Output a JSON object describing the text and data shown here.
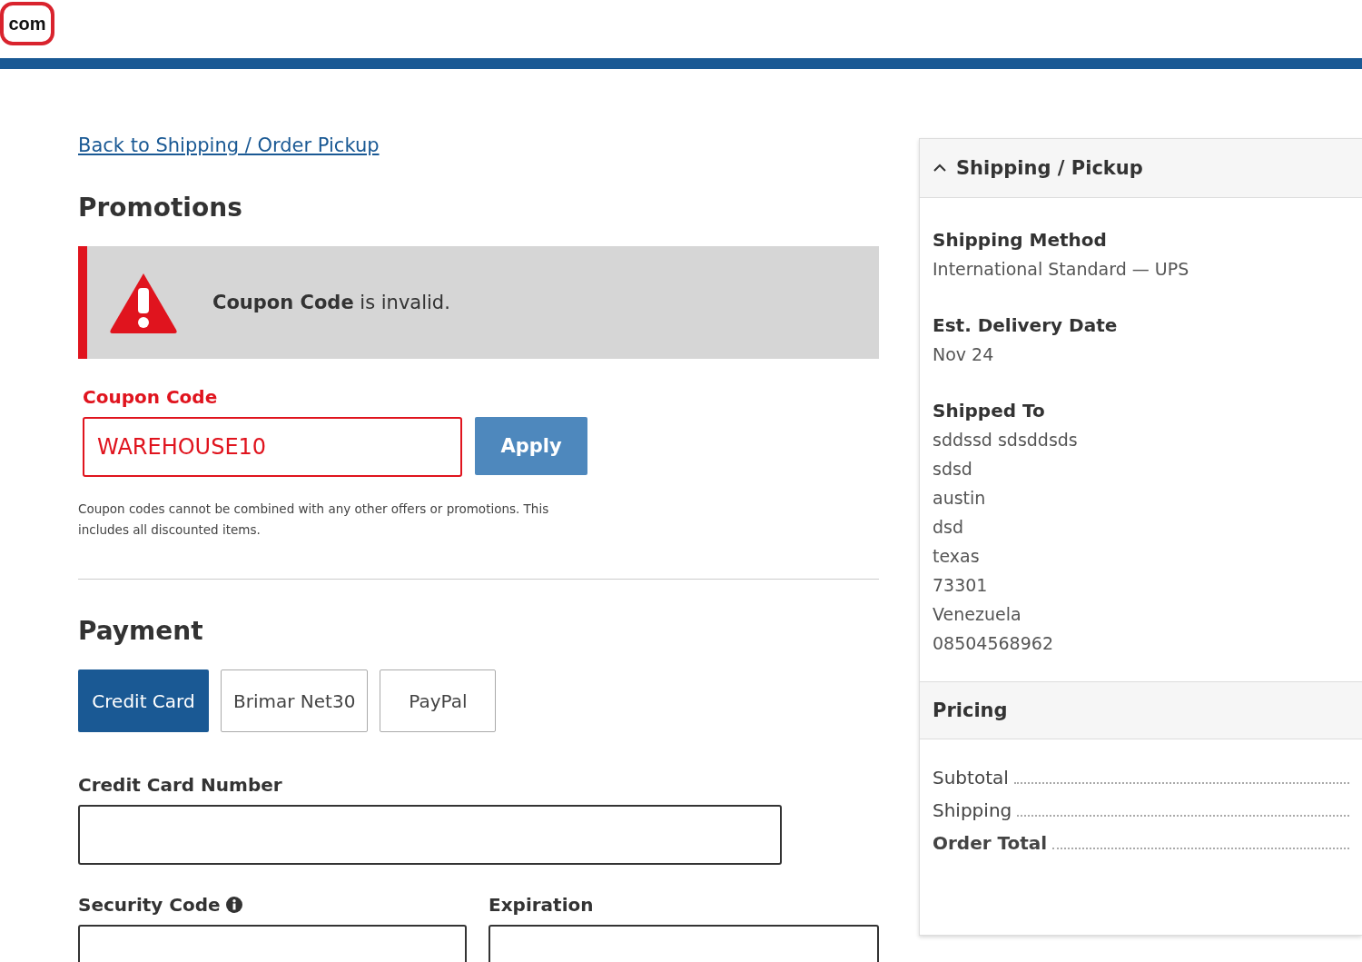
{
  "header": {
    "logo_text": "com"
  },
  "back_link": "Back to Shipping / Order Pickup",
  "promotions": {
    "title": "Promotions",
    "alert": {
      "kind": "error",
      "message": "**Coupon Code** is invalid."
    },
    "coupon": {
      "label": "Coupon Code",
      "value": "WAREHOUSE10",
      "invalid": true,
      "button": "Apply"
    },
    "note": "Coupon codes cannot be combined with any other offers or promotions. This includes all discounted items."
  },
  "payment": {
    "title": "Payment",
    "methods": [
      {
        "label": "Credit Card",
        "selected": true
      },
      {
        "label": "Brimar Net30",
        "selected": false
      },
      {
        "label": "PayPal",
        "selected": false
      }
    ],
    "card_number": {
      "label": "Credit Card Number"
    },
    "security_code": {
      "label": "Security Code"
    },
    "expiration": {
      "label": "Expiration"
    }
  },
  "summary": {
    "shipping": {
      "title": "Shipping / Pickup",
      "expanded": true,
      "sections": [
        {
          "label": "Shipping Method",
          "lines": [
            "International Standard — UPS"
          ]
        },
        {
          "label": "Est. Delivery Date",
          "lines": [
            "Nov 24"
          ]
        },
        {
          "label": "Shipped To",
          "lines": [
            "sddssd sdsddsds",
            "sdsd",
            "austin",
            "dsd",
            "texas",
            "73301",
            "Venezuela",
            "08504568962"
          ]
        }
      ]
    },
    "pricing": {
      "title": "Pricing",
      "rows": [
        {
          "label": "Subtotal",
          "bold": false
        },
        {
          "label": "Shipping",
          "bold": false
        },
        {
          "label": "Order Total",
          "bold": true
        }
      ]
    }
  }
}
